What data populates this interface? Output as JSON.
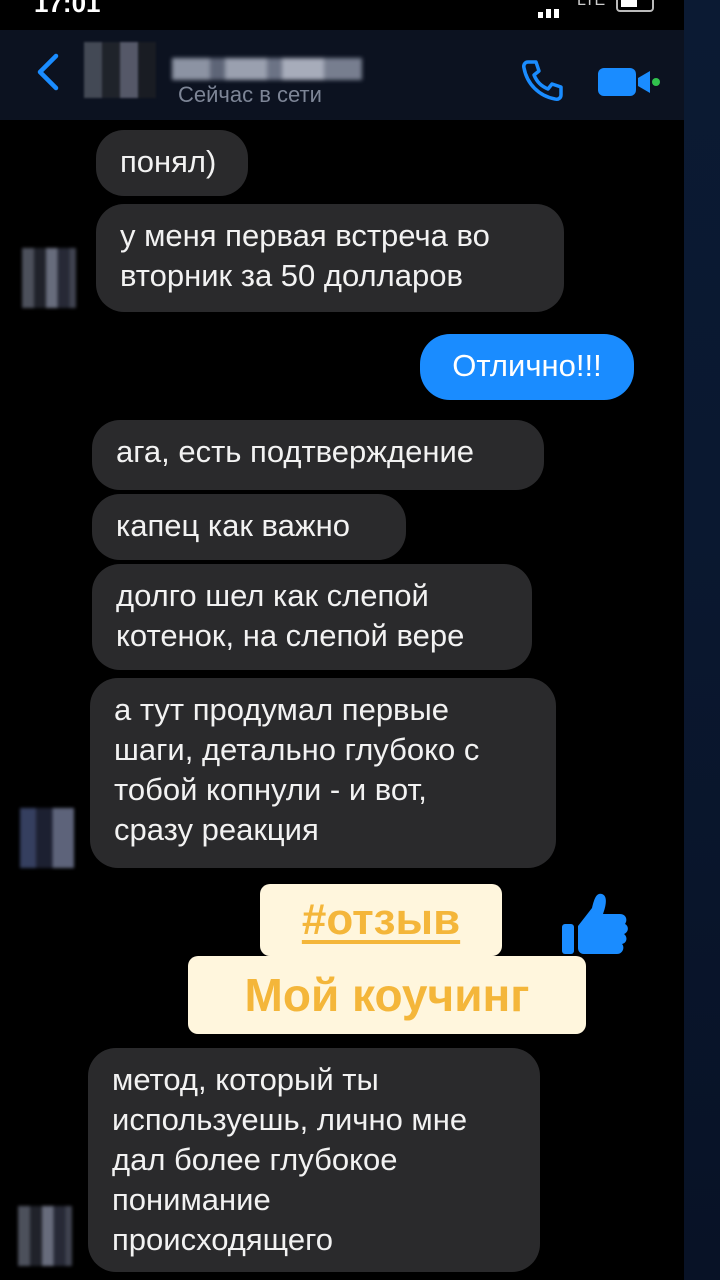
{
  "status_bar": {
    "time": "17:01",
    "network": "LTE"
  },
  "header": {
    "presence": "Сейчас в сети",
    "icons": [
      "back-chevron-icon",
      "phone-icon",
      "video-camera-icon"
    ],
    "accent": "#1a8cff"
  },
  "messages": [
    {
      "side": "in",
      "text": "понял)"
    },
    {
      "side": "in",
      "text": "у меня первая встреча во\nвторник за 50 долларов"
    },
    {
      "side": "out",
      "text": "Отлично!!!"
    },
    {
      "side": "in",
      "text": "ага, есть подтверждение"
    },
    {
      "side": "in",
      "text": "капец как важно"
    },
    {
      "side": "in",
      "text": "долго шел как слепой\nкотенок, на слепой вере"
    },
    {
      "side": "in",
      "text": "а тут продумал первые\nшаги, детально глубоко с\nтобой копнули - и вот,\nсразу реакция"
    },
    {
      "side": "in",
      "text": "метод, который ты\nиспользуешь, лично мне\nдал более глубокое\nпонимание\nпроисходящего"
    }
  ],
  "stickers": {
    "hashtag": "#отзыв",
    "title": "Мой коучинг",
    "color": "#f4b63a",
    "background": "#fff6dd",
    "icon": "thumbs-up-icon"
  }
}
